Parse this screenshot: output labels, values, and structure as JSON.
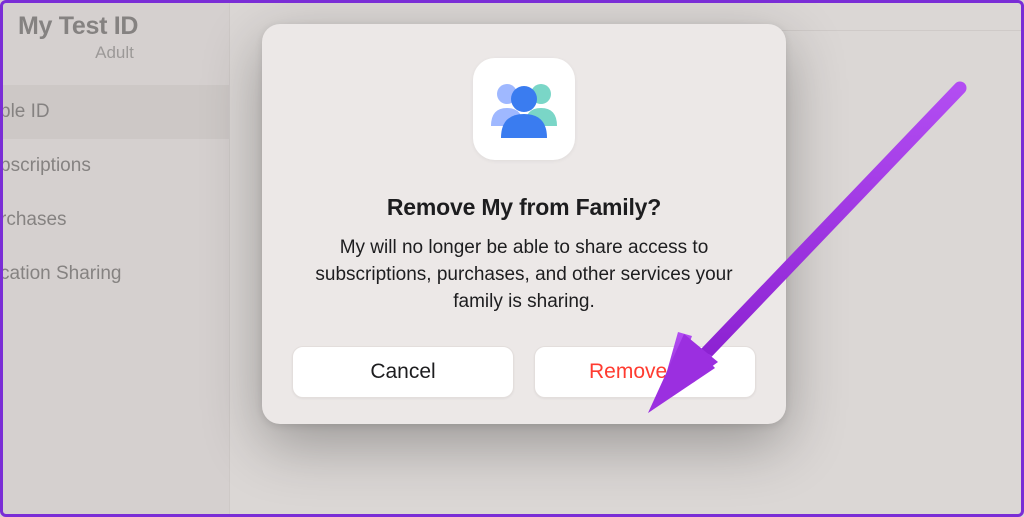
{
  "sidebar": {
    "title": "My Test ID",
    "subtitle": "Adult",
    "items": [
      {
        "label": "ple ID"
      },
      {
        "label": "bscriptions"
      },
      {
        "label": "rchases"
      },
      {
        "label": "cation Sharing"
      }
    ]
  },
  "dialog": {
    "icon": "family-sharing-icon",
    "title": "Remove My from Family?",
    "body": "My will no longer be able to share access to subscriptions, purchases, and other services your family is sharing.",
    "cancel_label": "Cancel",
    "confirm_label": "Remove My"
  },
  "annotation": {
    "arrow_color": "#9b2fe0"
  }
}
